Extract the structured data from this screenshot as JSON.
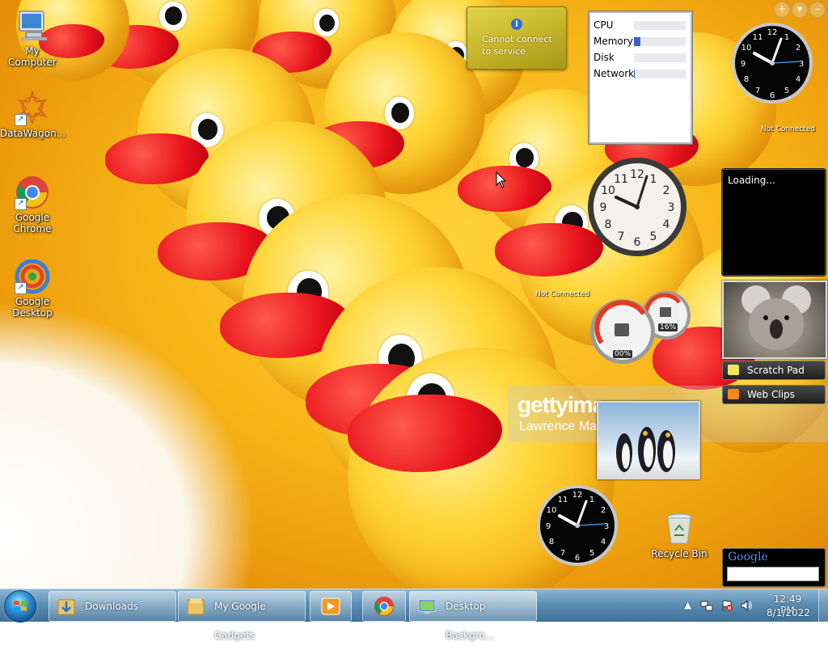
{
  "desktop": {
    "icons": [
      {
        "label": "My Computer"
      },
      {
        "label": "DataWagon..."
      },
      {
        "label": "Google Chrome"
      },
      {
        "label": "Google Desktop"
      },
      {
        "label": "Recycle Bin"
      }
    ]
  },
  "gadgets": {
    "service": {
      "text": "Cannot connect to service"
    },
    "meter": {
      "rows": [
        {
          "label": "CPU",
          "value": 0
        },
        {
          "label": "Memory",
          "value": 0.12
        },
        {
          "label": "Disk",
          "value": 0
        },
        {
          "label": "Network",
          "value": 0.02
        }
      ]
    },
    "not_connected": "Not Connected",
    "loading": "Loading...",
    "scratch_pad": "Scratch Pad",
    "web_clips": "Web Clips",
    "cpu_gauge": {
      "left": "00%",
      "right": "16%"
    },
    "google_logo": "Google",
    "watermark_brand": "gettyima",
    "watermark_credit": "Lawrence Ma"
  },
  "taskbar": {
    "buttons": [
      {
        "label": "Downloads"
      },
      {
        "label": "My Google Gadgets"
      },
      {
        "label": "Desktop Backgro..."
      }
    ],
    "time": "12:49 PM",
    "date": "8/1/2022"
  },
  "colors": {
    "accent": "#3a62c9",
    "taskbar": "#5c8fb5"
  }
}
